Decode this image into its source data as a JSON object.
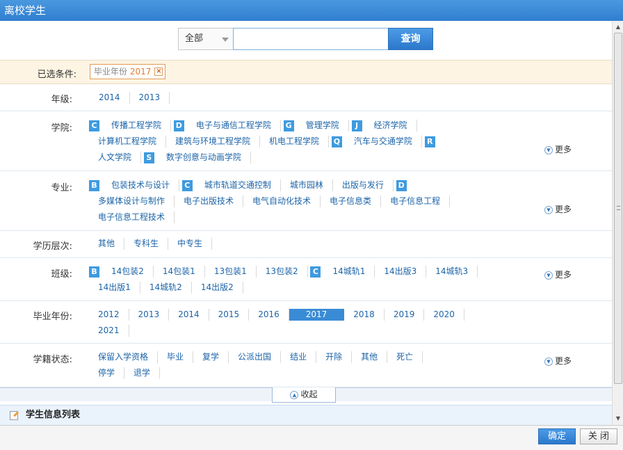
{
  "window": {
    "title": "离校学生"
  },
  "search": {
    "select_value": "全部",
    "input_value": "",
    "button_label": "查询"
  },
  "selected": {
    "label": "已选条件:",
    "chip_name": "毕业年份",
    "chip_value": "2017",
    "chip_close": "×"
  },
  "rows": {
    "grade": {
      "label": "年级:",
      "items": [
        "2014",
        "2013"
      ]
    },
    "college": {
      "label": "学院:",
      "more": "更多",
      "items": [
        {
          "letter": "C",
          "text": "传播工程学院"
        },
        {
          "letter": "D",
          "text": "电子与通信工程学院"
        },
        {
          "letter": "G",
          "text": "管理学院"
        },
        {
          "letter": "J",
          "text": "经济学院"
        },
        {
          "text": "计算机工程学院"
        },
        {
          "text": "建筑与环境工程学院"
        },
        {
          "text": "机电工程学院"
        },
        {
          "letter": "Q",
          "text": "汽车与交通学院"
        },
        {
          "letter": "R",
          "text": ""
        },
        {
          "text": "人文学院"
        },
        {
          "letter": "S",
          "text": "数字创意与动画学院"
        }
      ]
    },
    "major": {
      "label": "专业:",
      "more": "更多",
      "items": [
        {
          "letter": "B",
          "text": "包装技术与设计"
        },
        {
          "letter": "C",
          "text": "城市轨道交通控制"
        },
        {
          "text": "城市园林"
        },
        {
          "text": "出版与发行"
        },
        {
          "letter": "D",
          "text": ""
        },
        {
          "text": "多媒体设计与制作"
        },
        {
          "text": "电子出版技术"
        },
        {
          "text": "电气自动化技术"
        },
        {
          "text": "电子信息类"
        },
        {
          "text": "电子信息工程"
        },
        {
          "text": "电子信息工程技术"
        }
      ]
    },
    "level": {
      "label": "学历层次:",
      "items": [
        "其他",
        "专科生",
        "中专生"
      ]
    },
    "class": {
      "label": "班级:",
      "more": "更多",
      "items": [
        {
          "letter": "B",
          "text": "14包装2"
        },
        {
          "text": "14包装1"
        },
        {
          "text": "13包装1"
        },
        {
          "text": "13包装2"
        },
        {
          "letter": "C",
          "text": "14城轨1"
        },
        {
          "text": "14出版3"
        },
        {
          "text": "14城轨3"
        },
        {
          "text": "14出版1"
        },
        {
          "text": "14城轨2"
        },
        {
          "text": "14出版2"
        }
      ]
    },
    "gradyear": {
      "label": "毕业年份:",
      "items": [
        "2012",
        "2013",
        "2014",
        "2015",
        "2016",
        "2017",
        "2018",
        "2019",
        "2020",
        "2021"
      ],
      "selected": "2017"
    },
    "status": {
      "label": "学籍状态:",
      "more": "更多",
      "items": [
        "保留入学资格",
        "毕业",
        "复学",
        "公派出国",
        "结业",
        "开除",
        "其他",
        "死亡",
        "停学",
        "退学"
      ]
    }
  },
  "collapse": {
    "label": "收起"
  },
  "list": {
    "title": "学生信息列表"
  },
  "footer": {
    "ok": "确定",
    "close": "关 闭"
  },
  "colors": {
    "accent": "#3a8bd6",
    "title_bar": "#3a8ad6",
    "chip_border": "#e39a55"
  }
}
